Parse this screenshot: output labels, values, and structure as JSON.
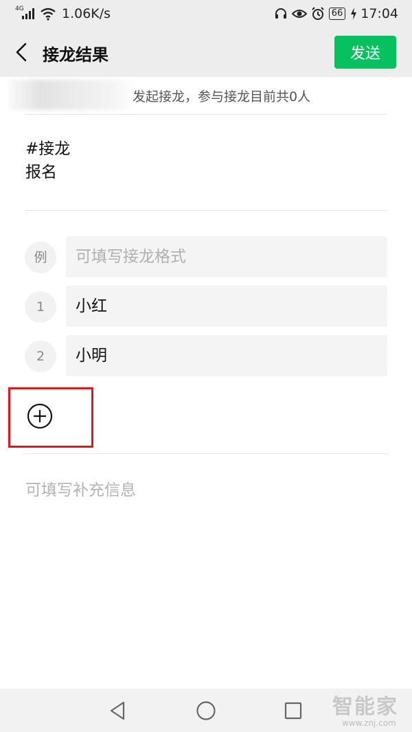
{
  "status_bar": {
    "network_type": "4G",
    "speed": "1.06K/s",
    "battery": "66",
    "time": "17:04"
  },
  "header": {
    "title": "接龙结果",
    "send_label": "发送",
    "accent_color": "#07c160"
  },
  "info": {
    "text": "发起接龙，参与接龙目前共0人"
  },
  "topic": {
    "line1": "#接龙",
    "line2": "报名"
  },
  "entries": [
    {
      "index": "例",
      "text": "可填写接龙格式",
      "is_placeholder": true
    },
    {
      "index": "1",
      "text": "小红",
      "is_placeholder": false
    },
    {
      "index": "2",
      "text": "小明",
      "is_placeholder": false
    }
  ],
  "add_entry": {
    "icon": "plus-circle-icon",
    "highlight_color": "#e0161b"
  },
  "extra_info": {
    "placeholder": "可填写补充信息"
  },
  "nav": {
    "back": "triangle-back-icon",
    "home": "circle-home-icon",
    "recents": "square-recents-icon"
  },
  "watermark": {
    "main": "智能家",
    "sub": "www.znj.com"
  }
}
